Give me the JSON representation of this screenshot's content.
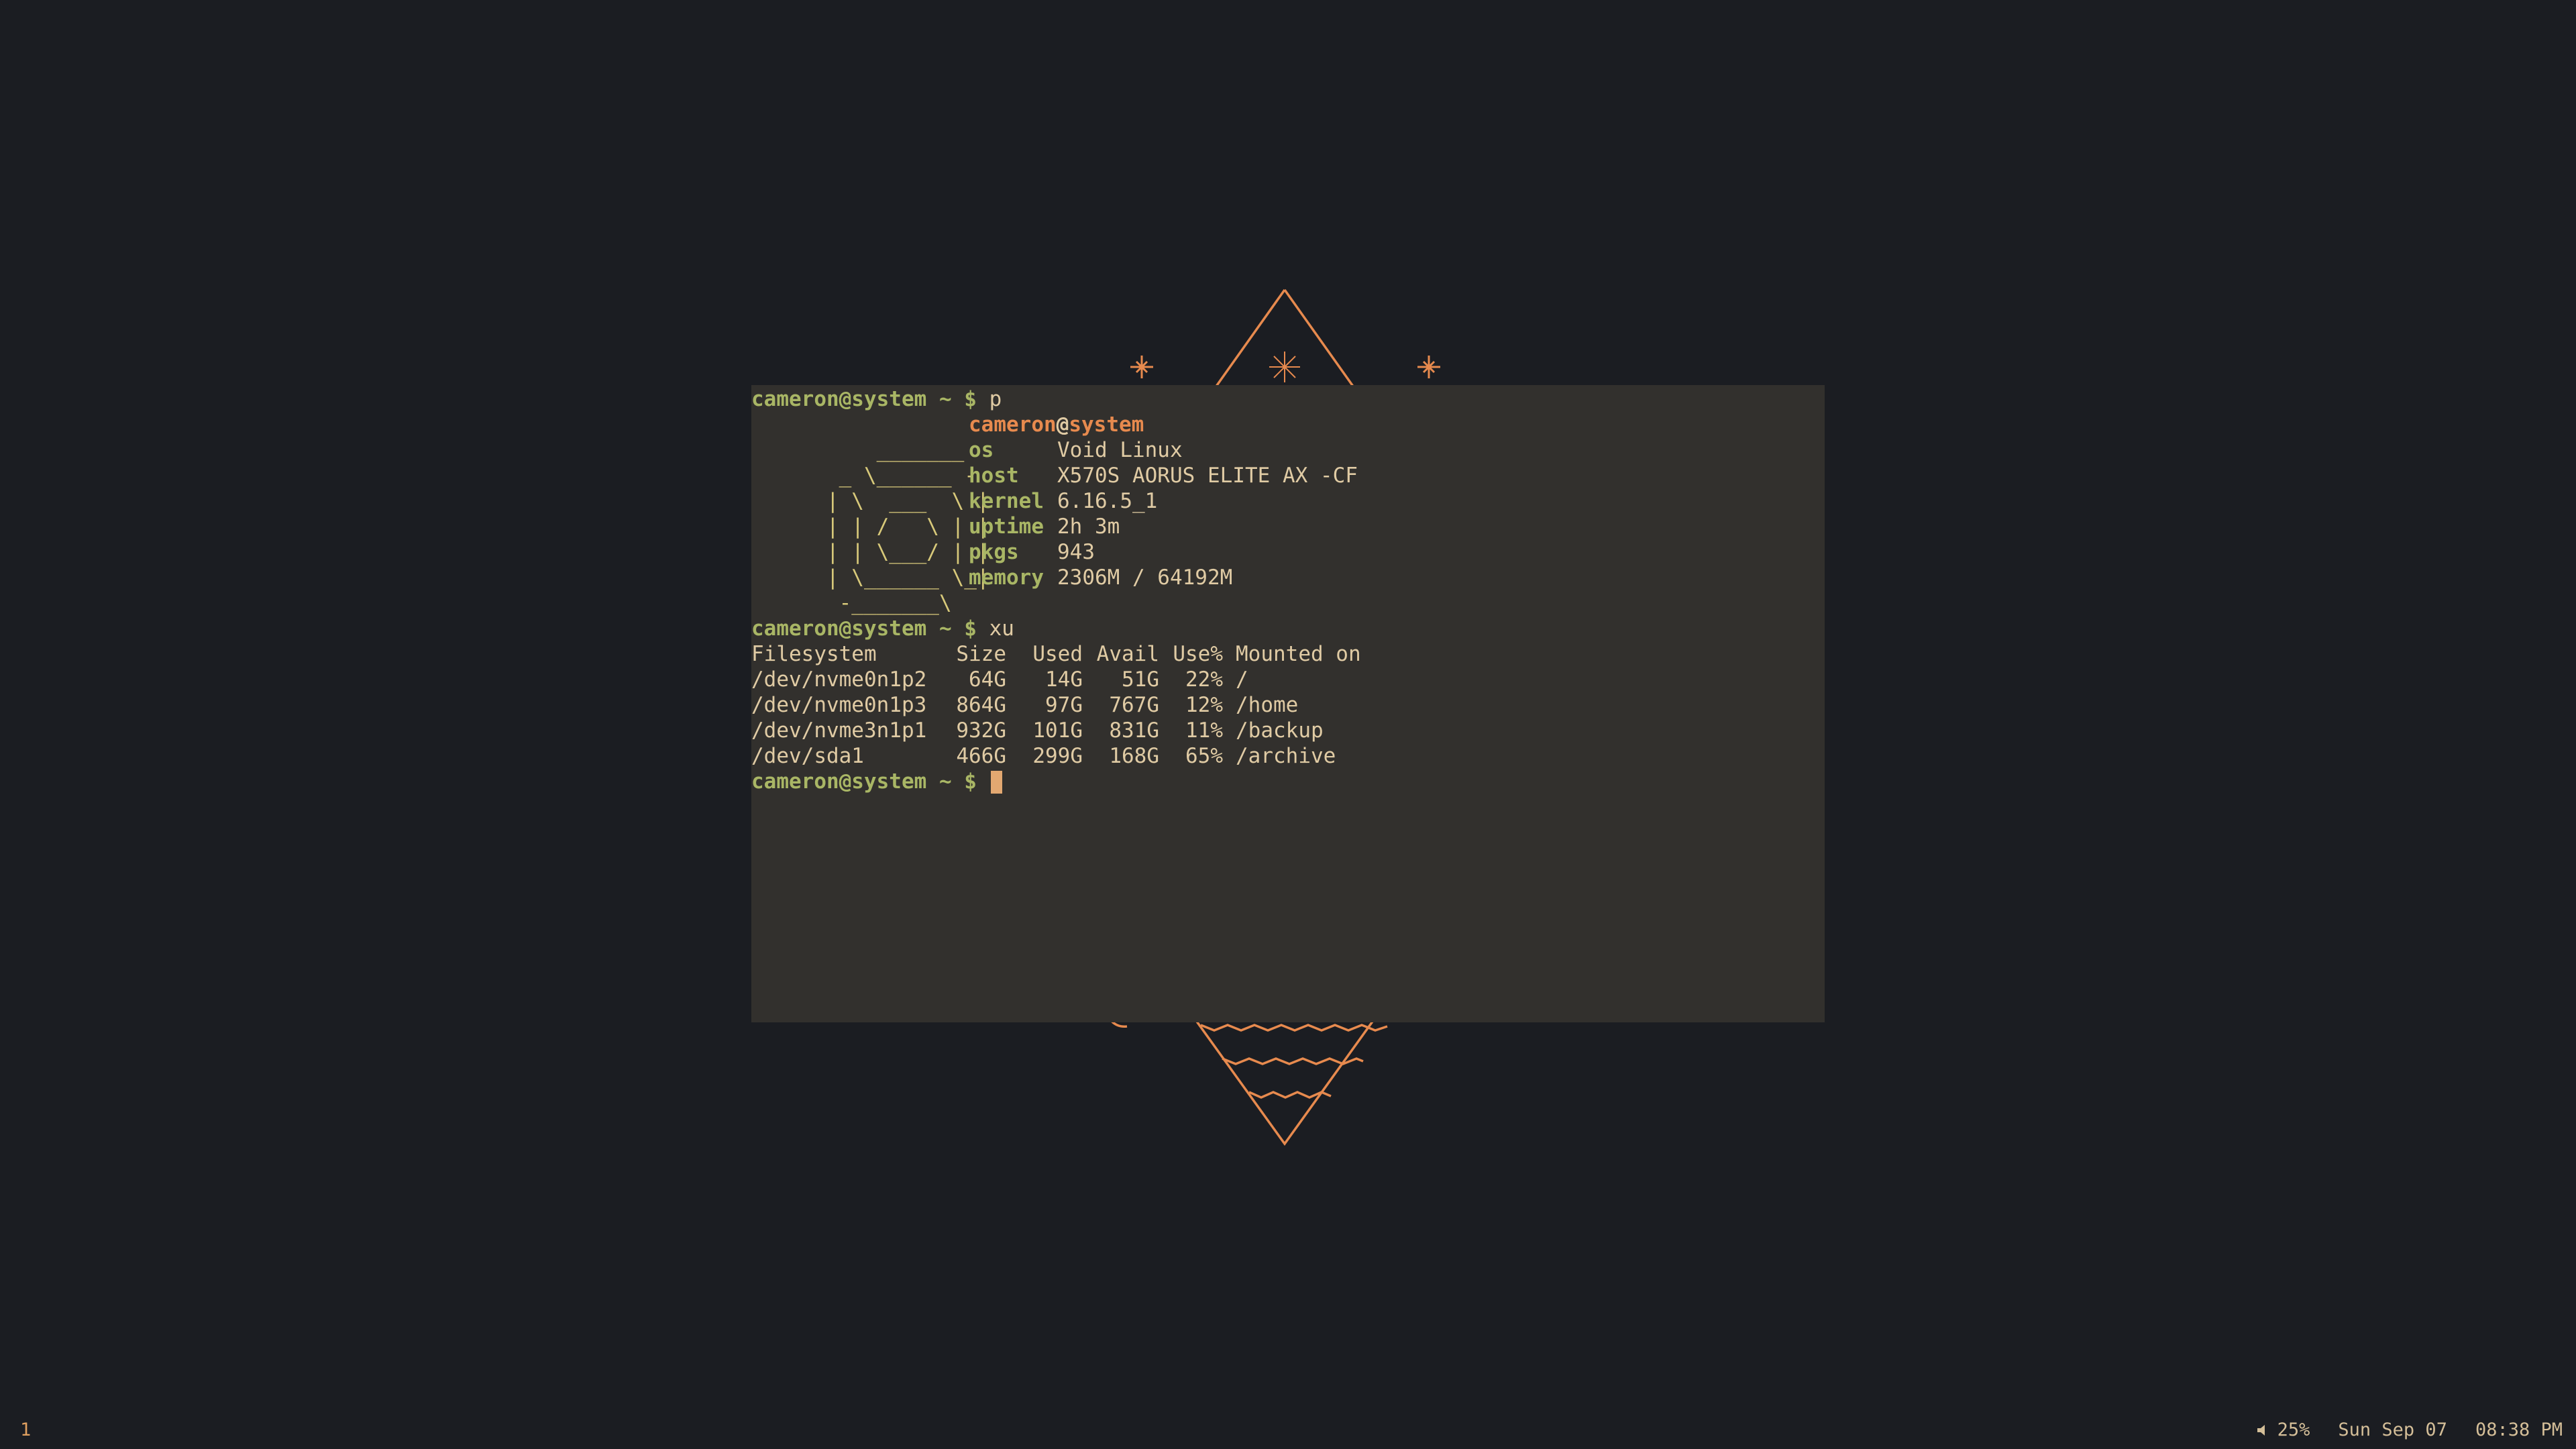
{
  "colors": {
    "background": "#1b1d22",
    "terminal_bg": "#32302d",
    "accent_orange": "#e78a4e",
    "user_green": "#a9b665",
    "text": "#e0cba4",
    "cursor": "#e3a871"
  },
  "terminal": {
    "prompt": {
      "user_host": "cameron@system",
      "path_dollar": " ~ $ "
    },
    "command1": "p",
    "fetch": {
      "art": [
        "    _______",
        " _ \\______ -",
        "| \\  ___  \\ |",
        "| | /   \\ | |",
        "| | \\___/ | |",
        "| \\______ \\_|",
        " -_______\\"
      ],
      "title_user": "cameron",
      "title_at": "@",
      "title_host": "system",
      "rows": [
        {
          "key": "os",
          "value": "Void Linux"
        },
        {
          "key": "host",
          "value": "X570S AORUS ELITE AX -CF"
        },
        {
          "key": "kernel",
          "value": "6.16.5_1"
        },
        {
          "key": "uptime",
          "value": "2h 3m"
        },
        {
          "key": "pkgs",
          "value": "943"
        },
        {
          "key": "memory",
          "value": "2306M / 64192M"
        }
      ]
    },
    "command2": "xu",
    "df": {
      "header": [
        "Filesystem",
        "Size",
        "Used",
        "Avail",
        "Use%",
        "Mounted on"
      ],
      "rows": [
        [
          "/dev/nvme0n1p2",
          "64G",
          "14G",
          "51G",
          "22%",
          "/"
        ],
        [
          "/dev/nvme0n1p3",
          "864G",
          "97G",
          "767G",
          "12%",
          "/home"
        ],
        [
          "/dev/nvme3n1p1",
          "932G",
          "101G",
          "831G",
          "11%",
          "/backup"
        ],
        [
          "/dev/sda1",
          "466G",
          "299G",
          "168G",
          "65%",
          "/archive"
        ]
      ]
    }
  },
  "statusbar": {
    "workspace": "1",
    "volume_icon": "speaker-icon",
    "volume": "25%",
    "date": "Sun Sep 07",
    "time": "08:38 PM"
  }
}
